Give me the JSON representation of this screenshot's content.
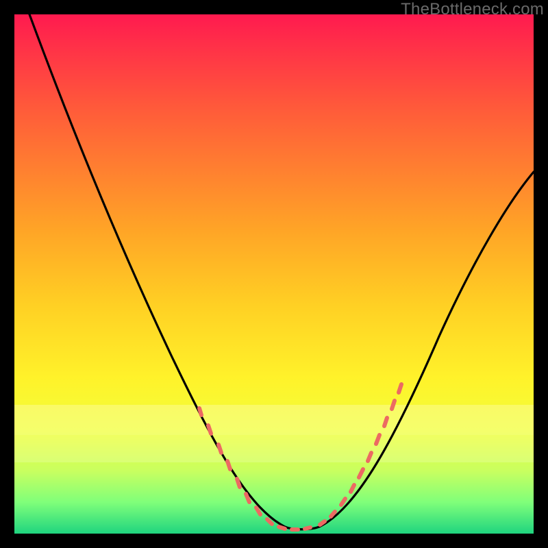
{
  "watermark": "TheBottleneck.com",
  "chart_data": {
    "type": "line",
    "title": "",
    "xlabel": "",
    "ylabel": "",
    "xlim": [
      0,
      100
    ],
    "ylim": [
      0,
      100
    ],
    "grid": false,
    "series": [
      {
        "name": "curve",
        "x": [
          3,
          8,
          14,
          20,
          26,
          32,
          38,
          44,
          49,
          53,
          56,
          58,
          62,
          66,
          70,
          76,
          84,
          92,
          100
        ],
        "y": [
          100,
          90,
          78,
          66,
          55,
          44,
          33,
          22,
          13,
          7,
          3,
          1,
          3,
          7,
          13,
          21,
          33,
          46,
          60
        ]
      }
    ],
    "markers": {
      "left": {
        "x_range": [
          38,
          53
        ],
        "y_range": [
          3,
          33
        ]
      },
      "right": {
        "x_range": [
          62,
          77
        ],
        "y_range": [
          3,
          33
        ]
      }
    },
    "colors": {
      "gradient_top": "#ff1a4f",
      "gradient_bottom": "#1fd47f",
      "curve": "#000000",
      "markers": "#ec6a62"
    }
  }
}
